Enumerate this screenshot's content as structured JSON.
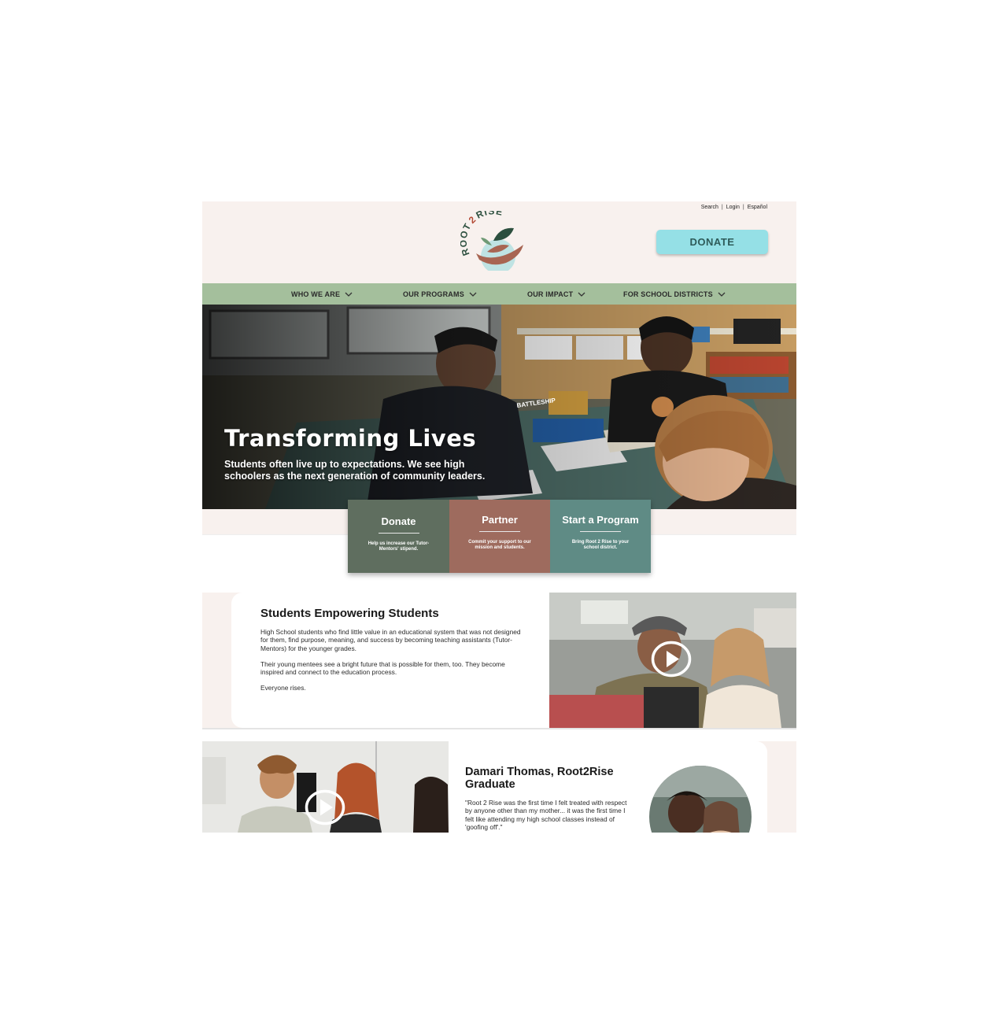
{
  "utility": {
    "search": "Search",
    "login": "Login",
    "language": "Español",
    "separator": "|"
  },
  "logo": {
    "text_root": "ROOT",
    "text_2": "2",
    "text_rise": "RISE"
  },
  "header": {
    "donate_label": "DONATE"
  },
  "nav": {
    "items": [
      {
        "label": "WHO WE ARE"
      },
      {
        "label": "OUR PROGRAMS"
      },
      {
        "label": "OUR IMPACT"
      },
      {
        "label": "FOR SCHOOL DISTRICTS"
      }
    ]
  },
  "hero": {
    "title": "Transforming Lives",
    "subtitle": "Students often live up to expectations. We see high schoolers as the next generation of community leaders.",
    "photo_text": "BATTLESHIP"
  },
  "cards": [
    {
      "title": "Donate",
      "text": "Help us increase our Tutor-Mentors' stipend.",
      "color": "#5f6e5f"
    },
    {
      "title": "Partner",
      "text": "Commit your support to our mission and students.",
      "color": "#9e6b5e"
    },
    {
      "title": "Start a Program",
      "text": "Bring Root 2 Rise to your school district.",
      "color": "#5f8b85"
    }
  ],
  "section1": {
    "title": "Students Empowering Students",
    "paragraphs": [
      "High School students who find little value in an educational system that was not designed for them, find purpose, meaning, and success by becoming teaching assistants (Tutor-Mentors) for the younger grades.",
      "Their young mentees see a bright future that is possible for them, too. They become inspired and connect to the education process.",
      "Everyone rises."
    ],
    "video_icon": "play-icon"
  },
  "section2": {
    "name": "Damari Thomas, Root2Rise Graduate",
    "quote": "\"Root 2 Rise was the first time I felt treated with respect by anyone other than my mother... it was the first time I felt like attending my high school classes instead of 'goofing off'.\"",
    "video_icon": "play-icon"
  },
  "colors": {
    "header_bg": "#f8f1ee",
    "nav_bg": "#a4bf9c",
    "donate_button": "#95e0e6",
    "donate_text": "#2e5b59"
  }
}
